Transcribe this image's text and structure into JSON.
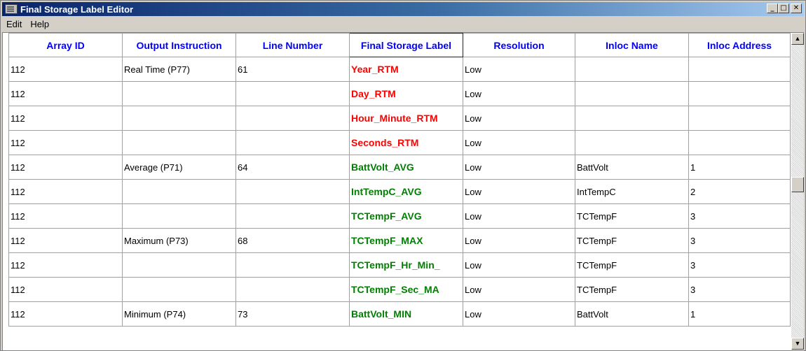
{
  "window": {
    "title": "Final Storage Label Editor",
    "buttons": {
      "minimize": "_",
      "maximize": "□",
      "close": "✕"
    }
  },
  "menu": [
    "Edit",
    "Help"
  ],
  "colors": {
    "red": "#ff0000",
    "green": "#008000",
    "header": "#0000ff"
  },
  "table": {
    "headers": [
      "Array ID",
      "Output Instruction",
      "Line Number",
      "Final Storage Label",
      "Resolution",
      "Inloc Name",
      "Inloc Address"
    ],
    "rows": [
      {
        "array_id": "112",
        "output_instruction": "Real Time (P77)",
        "line_number": "61",
        "label": "Year_RTM",
        "label_color": "red",
        "resolution": "Low",
        "inloc_name": "",
        "inloc_address": ""
      },
      {
        "array_id": "112",
        "output_instruction": "",
        "line_number": "",
        "label": "Day_RTM",
        "label_color": "red",
        "resolution": "Low",
        "inloc_name": "",
        "inloc_address": ""
      },
      {
        "array_id": "112",
        "output_instruction": "",
        "line_number": "",
        "label": "Hour_Minute_RTM",
        "label_color": "red",
        "resolution": "Low",
        "inloc_name": "",
        "inloc_address": ""
      },
      {
        "array_id": "112",
        "output_instruction": "",
        "line_number": "",
        "label": "Seconds_RTM",
        "label_color": "red",
        "resolution": "Low",
        "inloc_name": "",
        "inloc_address": ""
      },
      {
        "array_id": "112",
        "output_instruction": "Average (P71)",
        "line_number": "64",
        "label": "BattVolt_AVG",
        "label_color": "green",
        "resolution": "Low",
        "inloc_name": "BattVolt",
        "inloc_address": "1"
      },
      {
        "array_id": "112",
        "output_instruction": "",
        "line_number": "",
        "label": "IntTempC_AVG",
        "label_color": "green",
        "resolution": "Low",
        "inloc_name": "IntTempC",
        "inloc_address": "2"
      },
      {
        "array_id": "112",
        "output_instruction": "",
        "line_number": "",
        "label": "TCTempF_AVG",
        "label_color": "green",
        "resolution": "Low",
        "inloc_name": "TCTempF",
        "inloc_address": "3"
      },
      {
        "array_id": "112",
        "output_instruction": "Maximum (P73)",
        "line_number": "68",
        "label": "TCTempF_MAX",
        "label_color": "green",
        "resolution": "Low",
        "inloc_name": "TCTempF",
        "inloc_address": "3"
      },
      {
        "array_id": "112",
        "output_instruction": "",
        "line_number": "",
        "label": "TCTempF_Hr_Min_",
        "label_color": "green",
        "resolution": "Low",
        "inloc_name": "TCTempF",
        "inloc_address": "3"
      },
      {
        "array_id": "112",
        "output_instruction": "",
        "line_number": "",
        "label": "TCTempF_Sec_MA",
        "label_color": "green",
        "resolution": "Low",
        "inloc_name": "TCTempF",
        "inloc_address": "3"
      },
      {
        "array_id": "112",
        "output_instruction": "Minimum (P74)",
        "line_number": "73",
        "label": "BattVolt_MIN",
        "label_color": "green",
        "resolution": "Low",
        "inloc_name": "BattVolt",
        "inloc_address": "1"
      }
    ]
  },
  "scrollbar": {
    "up_icon": "▲",
    "down_icon": "▼"
  }
}
